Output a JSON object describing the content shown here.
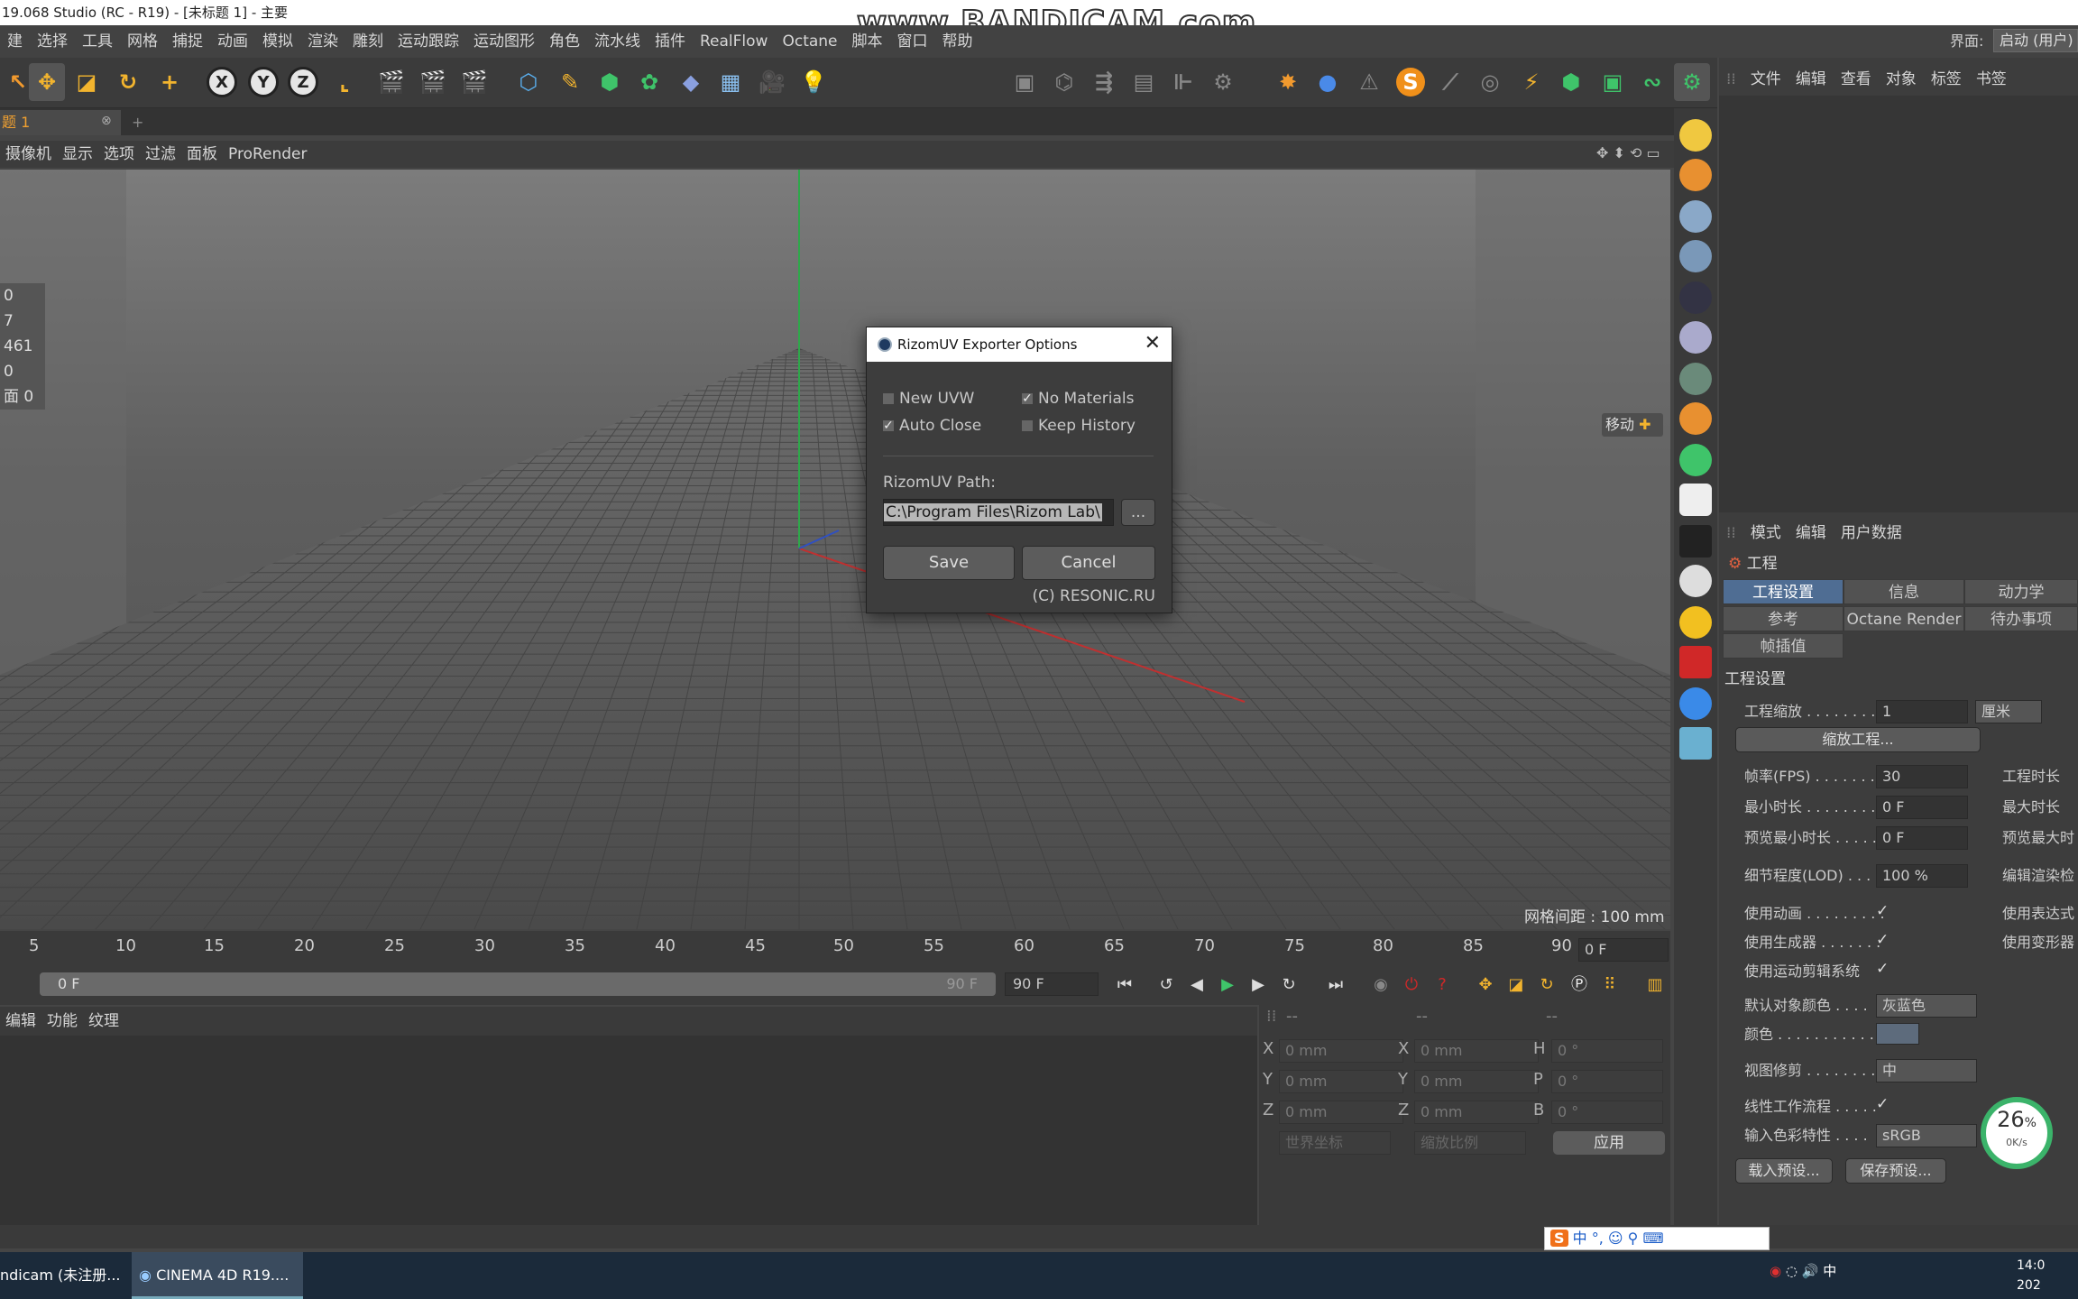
{
  "window": {
    "title": "19.068 Studio (RC - R19) - [未标题 1] - 主要"
  },
  "watermark": "www.BANDICAM.com",
  "menu": [
    "建",
    "选择",
    "工具",
    "网格",
    "捕捉",
    "动画",
    "模拟",
    "渲染",
    "雕刻",
    "运动跟踪",
    "运动图形",
    "角色",
    "流水线",
    "插件",
    "RealFlow",
    "Octane",
    "脚本",
    "窗口",
    "帮助"
  ],
  "layout": {
    "label": "界面:",
    "value": "启动 (用户)"
  },
  "toolbar_icons": [
    "live-select-icon",
    "move-icon",
    "scale-icon",
    "rotate-icon",
    "add-icon",
    "x-axis-icon",
    "y-axis-icon",
    "z-axis-icon",
    "coordinate-system-icon",
    "render-view-icon",
    "render-picture-queue-icon",
    "render-settings-icon",
    "cube-icon",
    "pen-icon",
    "subdivision-icon",
    "cloner-icon",
    "deformer-icon",
    "floor-icon",
    "camera-icon",
    "light-icon"
  ],
  "axes": {
    "x": "X",
    "y": "Y",
    "z": "Z"
  },
  "tab": {
    "label": "题 1",
    "close": "⊗",
    "add": "+"
  },
  "viewport_menu": [
    "摄像机",
    "显示",
    "选项",
    "过滤",
    "面板",
    "ProRender"
  ],
  "stats": [
    "0",
    "7",
    "461",
    "0",
    "面 0"
  ],
  "move_label": "移动",
  "grid_spacing": "网格间距 : 100 mm",
  "object_menu": [
    "文件",
    "编辑",
    "查看",
    "对象",
    "标签",
    "书签"
  ],
  "attr_menu": [
    "模式",
    "编辑",
    "用户数据"
  ],
  "project": {
    "title": "工程",
    "tabs": [
      {
        "label": "工程设置",
        "active": true
      },
      {
        "label": "信息"
      },
      {
        "label": "动力学"
      },
      {
        "label": "参考"
      },
      {
        "label": "Octane Render"
      },
      {
        "label": "待办事项"
      },
      {
        "label": "帧插值"
      }
    ],
    "section": "工程设置",
    "scale_label": "工程缩放 . . . . . . . . .",
    "scale_value": "1",
    "scale_unit": "厘米",
    "scale_button": "缩放工程...",
    "fps_label": "帧率(FPS) . . . . . . . .",
    "fps_value": "30",
    "project_time_label": "工程时长",
    "min_time_label": "最小时长 . . . . . . . . .",
    "min_time_value": "0 F",
    "max_time_label": "最大时长",
    "preview_min_label": "预览最小时长 . . . . .",
    "preview_min_value": "0 F",
    "preview_max_label": "预览最大时",
    "lod_label": "细节程度(LOD) . . .",
    "lod_value": "100 %",
    "render_lod_label": "编辑渲染检",
    "use_anim_label": "使用动画 . . . . . . . . .",
    "use_expr_label": "使用表达式",
    "use_gen_label": "使用生成器 . . . . . . .",
    "use_deform_label": "使用变形器",
    "use_motion_label": "使用运动剪辑系统",
    "obj_color_label": "默认对象颜色 . . . .",
    "obj_color_value": "灰蓝色",
    "color_label": "颜色 . . . . . . . . . . . . .",
    "view_clip_label": "视图修剪 . . . . . . . . .",
    "view_clip_value": "中",
    "linear_label": "线性工作流程 . . . . .",
    "input_color_label": "输入色彩特性 . . . .",
    "input_color_value": "sRGB",
    "load_preset": "载入预设...",
    "save_preset": "保存预设...",
    "check": "✓"
  },
  "timeline": {
    "ticks": [
      "5",
      "10",
      "15",
      "20",
      "25",
      "30",
      "35",
      "40",
      "45",
      "50",
      "55",
      "60",
      "65",
      "70",
      "75",
      "80",
      "85",
      "90"
    ],
    "frame": "0 F"
  },
  "transport": {
    "start": "0 F",
    "end": "90 F",
    "end_field": "90 F"
  },
  "material_menu": [
    "编辑",
    "功能",
    "纹理"
  ],
  "coord": {
    "headers": [
      "--",
      "--",
      "--"
    ],
    "pos": [
      {
        "axis": "X",
        "value": "0 mm"
      },
      {
        "axis": "Y",
        "value": "0 mm"
      },
      {
        "axis": "Z",
        "value": "0 mm"
      }
    ],
    "size": [
      {
        "axis": "X",
        "value": "0 mm"
      },
      {
        "axis": "Y",
        "value": "0 mm"
      },
      {
        "axis": "Z",
        "value": "0 mm"
      }
    ],
    "rot": [
      {
        "axis": "H",
        "value": "0 °"
      },
      {
        "axis": "P",
        "value": "0 °"
      },
      {
        "axis": "B",
        "value": "0 °"
      }
    ],
    "world": "世界坐标",
    "scale": "缩放比例",
    "apply": "应用"
  },
  "ime": "中 °, ☺ ⚲ ⌨",
  "net": {
    "percent": "26",
    "unit": "%",
    "speed": "0K/s"
  },
  "taskbar": [
    {
      "label": "ndicam (未注册..."
    },
    {
      "label": "CINEMA 4D R19...."
    }
  ],
  "tray": {
    "ime": "中",
    "date": "202",
    "time": "14:0"
  },
  "dialog": {
    "title": "RizomUV Exporter Options",
    "close": "✕",
    "new_uvw": "New UVW",
    "no_materials": "No Materials",
    "auto_close": "Auto Close",
    "keep_history": "Keep History",
    "path_label": "RizomUV Path:",
    "path_value": "C:\\Program Files\\Rizom Lab\\",
    "browse": "...",
    "save": "Save",
    "cancel": "Cancel",
    "copyright": "(C) RESONIC.RU"
  }
}
